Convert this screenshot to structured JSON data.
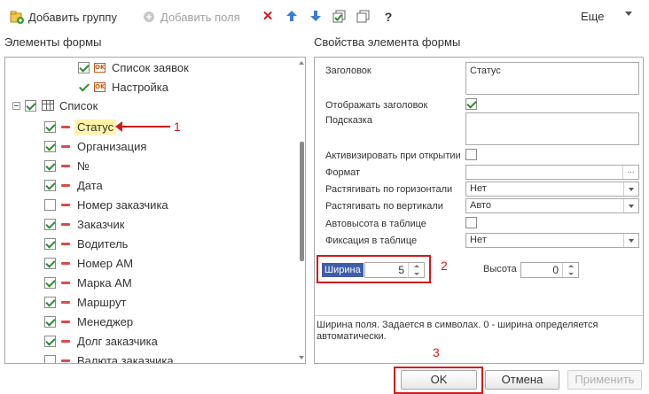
{
  "toolbar": {
    "add_group_label": "Добавить группу",
    "add_field_label": "Добавить поля",
    "more_label": "Еще",
    "help_label": "?"
  },
  "left_panel": {
    "title": "Элементы формы",
    "items": [
      {
        "label": "Список заявок"
      },
      {
        "label": "Настройка"
      },
      {
        "label": "Список"
      },
      {
        "label": "Статус",
        "checked": true
      },
      {
        "label": "Организация",
        "checked": true
      },
      {
        "label": "№",
        "checked": true
      },
      {
        "label": "Дата",
        "checked": true
      },
      {
        "label": "Номер заказчика",
        "checked": false
      },
      {
        "label": "Заказчик",
        "checked": true
      },
      {
        "label": "Водитель",
        "checked": true
      },
      {
        "label": "Номер АМ",
        "checked": true
      },
      {
        "label": "Марка АМ",
        "checked": true
      },
      {
        "label": "Маршрут",
        "checked": true
      },
      {
        "label": "Менеджер",
        "checked": true
      },
      {
        "label": "Долг заказчика",
        "checked": true
      },
      {
        "label": "Валюта заказчика",
        "checked": false
      }
    ]
  },
  "right_panel": {
    "title": "Свойства элемента формы",
    "header_label": "Заголовок",
    "header_value": "Статус",
    "show_header_label": "Отображать заголовок",
    "tooltip_label": "Подсказка",
    "activate_label": "Активизировать при открытии",
    "format_label": "Формат",
    "hstretch_label": "Растягивать по горизонтали",
    "hstretch_value": "Нет",
    "vstretch_label": "Растягивать по вертикали",
    "vstretch_value": "Авто",
    "autoheight_label": "Автовысота в таблице",
    "fix_label": "Фиксация в таблице",
    "fix_value": "Нет",
    "width_label": "Ширина",
    "width_value": "5",
    "height_label": "Высота",
    "height_value": "0",
    "hint_text": "Ширина поля. Задается в символах. 0 - ширина определяется автоматически."
  },
  "annotations": {
    "one": "1",
    "two": "2",
    "three": "3"
  },
  "footer": {
    "ok_label": "OK",
    "cancel_label": "Отмена",
    "apply_label": "Применить"
  },
  "colors": {
    "accent_red": "#d21a1a",
    "selection_blue": "#3f5ea8",
    "check_green": "#2e8b2e"
  }
}
